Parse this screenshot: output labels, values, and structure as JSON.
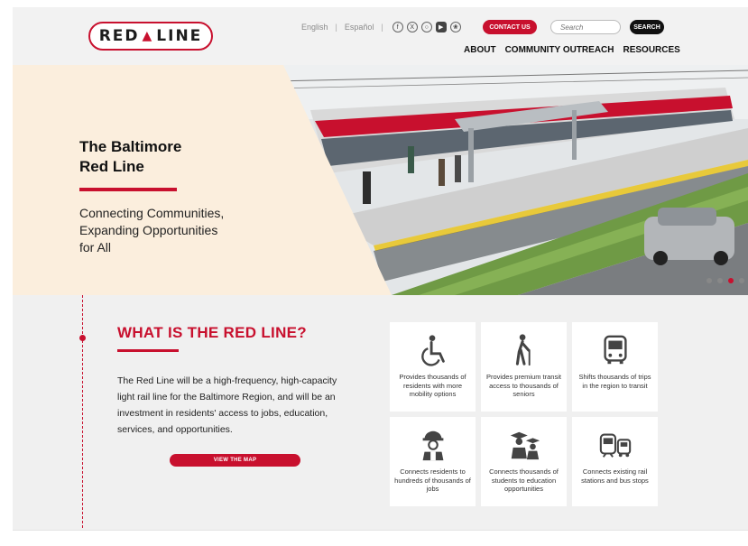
{
  "header": {
    "logo_left": "RED",
    "logo_right": "LINE",
    "languages": [
      "English",
      "Español"
    ],
    "social_icons": [
      "facebook-icon",
      "x-icon",
      "instagram-icon",
      "youtube-icon",
      "bluesky-icon"
    ],
    "contact_label": "CONTACT US",
    "search_placeholder": "Search",
    "search_label": "SEARCH",
    "nav": [
      "ABOUT",
      "COMMUNITY OUTREACH",
      "RESOURCES"
    ]
  },
  "hero": {
    "title_line1": "The Baltimore",
    "title_line2": "Red Line",
    "tagline_line1": "Connecting Communities,",
    "tagline_line2": "Expanding Opportunities",
    "tagline_line3": "for All",
    "slides": 4,
    "active_slide": 3
  },
  "what_is": {
    "title": "WHAT IS THE RED LINE?",
    "body": "The Red Line will be a high-frequency, high-capacity light rail line for the Baltimore Region, and will be an investment in residents' access to jobs, education, services, and opportunities.",
    "button_label": "VIEW THE MAP"
  },
  "benefits": [
    {
      "icon": "wheelchair-icon",
      "text": "Provides thousands of residents with more mobility options"
    },
    {
      "icon": "senior-cane-icon",
      "text": "Provides premium transit access to thousands of seniors"
    },
    {
      "icon": "bus-icon",
      "text": "Shifts thousands of trips in the region to transit"
    },
    {
      "icon": "worker-hardhat-icon",
      "text": "Connects residents to hundreds of thousands of jobs"
    },
    {
      "icon": "graduates-icon",
      "text": "Connects thousands of students to education opportunities"
    },
    {
      "icon": "train-bus-icon",
      "text": "Connects existing rail stations and bus stops"
    }
  ],
  "colors": {
    "brand_red": "#c8102e",
    "hero_panel": "#fbeedd",
    "background": "#f0f0f0"
  }
}
